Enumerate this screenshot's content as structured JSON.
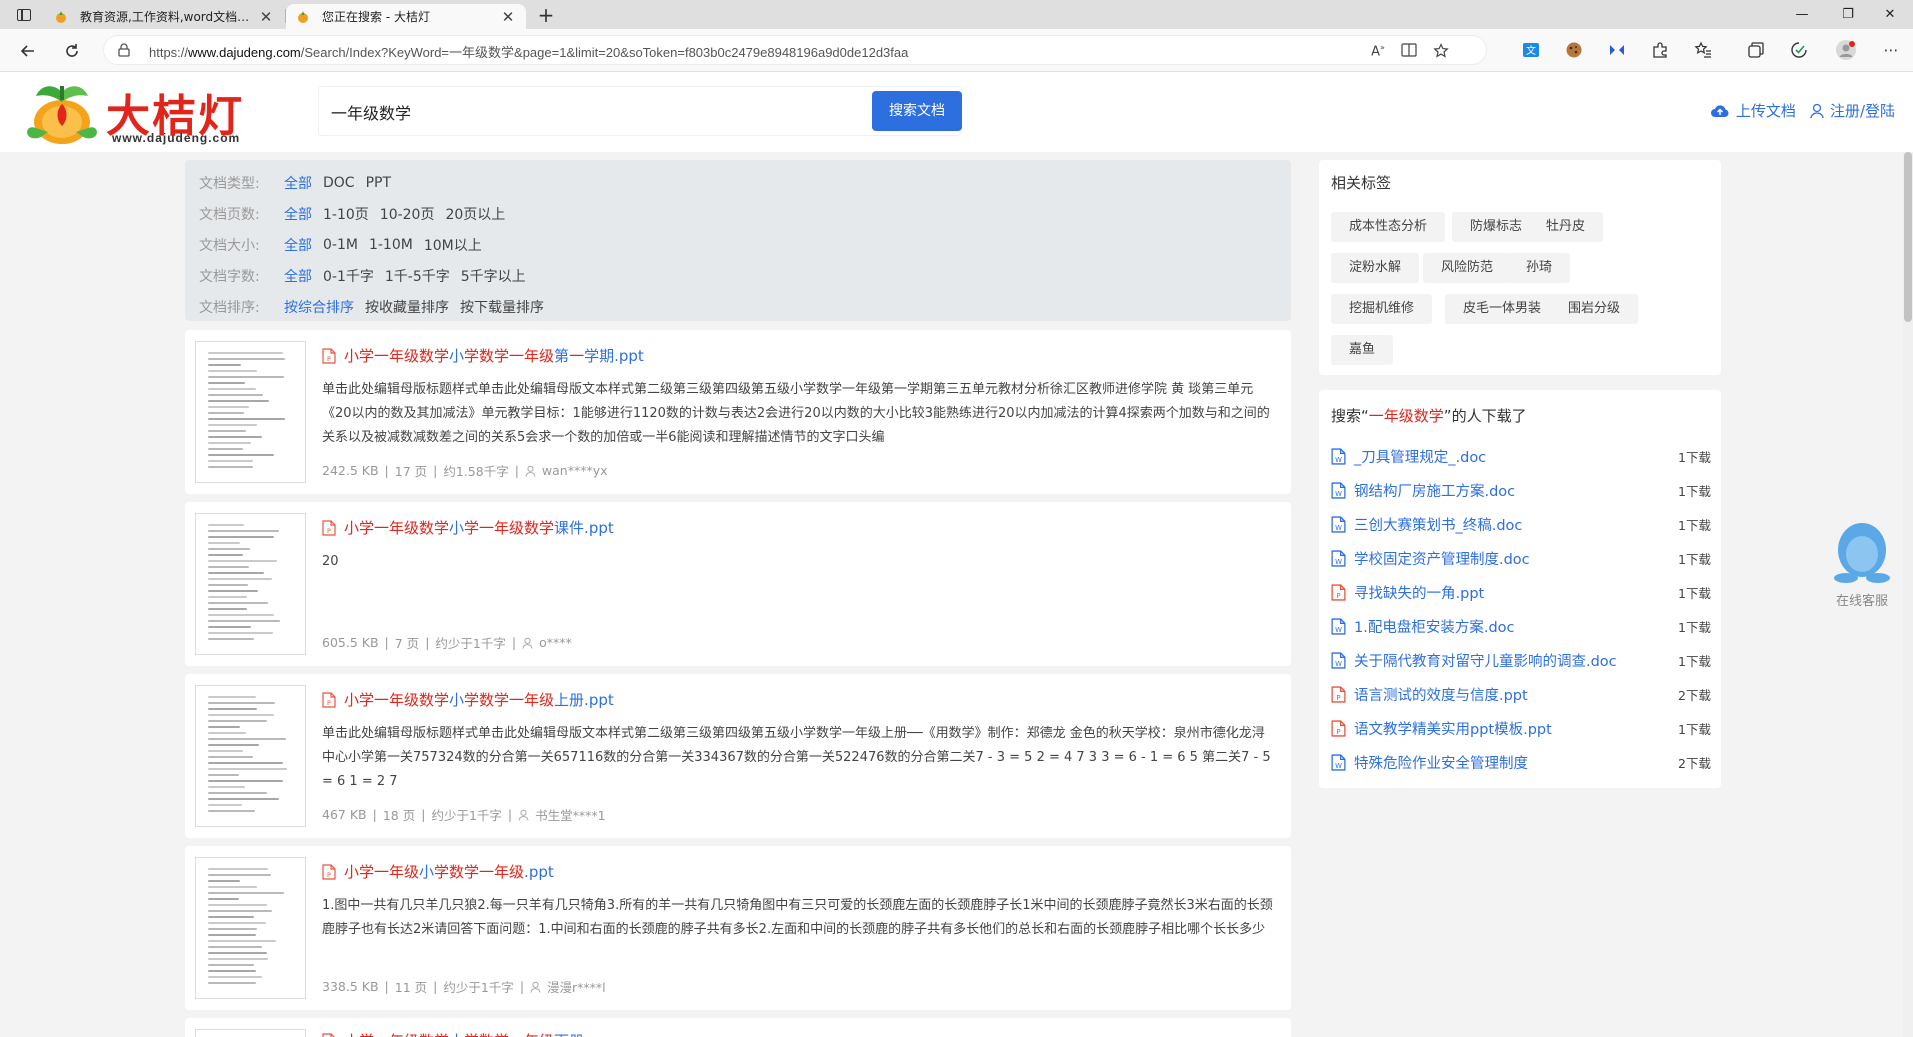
{
  "browser": {
    "tabs": [
      {
        "title": "教育资源,工作资料,word文档,课件",
        "active": false
      },
      {
        "title": "您正在搜索 - 大桔灯",
        "active": true
      }
    ],
    "url_prefix": "https://",
    "url_host": "www.dajudeng.com",
    "url_path": "/Search/Index?KeyWord=一年级数学&page=1&limit=20&soToken=f803b0c2479e8948196a9d0de12d3faa",
    "window_controls": {
      "minimize": "—",
      "restore": "❐",
      "close": "✕"
    }
  },
  "header": {
    "logo_text": "大桔灯",
    "logo_domain": "www.dajudeng.com",
    "search_value": "一年级数学",
    "search_button": "搜索文档",
    "upload_label": "上传文档",
    "login_label": "注册/登陆"
  },
  "filters": [
    {
      "label": "文档类型:",
      "options": [
        "全部",
        "DOC",
        "PPT"
      ],
      "active": 0
    },
    {
      "label": "文档页数:",
      "options": [
        "全部",
        "1-10页",
        "10-20页",
        "20页以上"
      ],
      "active": 0
    },
    {
      "label": "文档大小:",
      "options": [
        "全部",
        "0-1M",
        "1-10M",
        "10M以上"
      ],
      "active": 0
    },
    {
      "label": "文档字数:",
      "options": [
        "全部",
        "0-1千字",
        "1千-5千字",
        "5千字以上"
      ],
      "active": 0
    },
    {
      "label": "文档排序:",
      "options": [
        "按综合排序",
        "按收藏量排序",
        "按下载量排序"
      ],
      "active": 0
    }
  ],
  "results": [
    {
      "title_parts": [
        {
          "t": "小学一年级数学",
          "hl": true
        },
        {
          "t": "小",
          "hl": false
        },
        {
          "t": "学数学一年级",
          "hl": true
        },
        {
          "t": "第",
          "hl": false
        },
        {
          "t": "一",
          "hl": true
        },
        {
          "t": "学期.ppt",
          "hl": false
        }
      ],
      "desc": "单击此处编辑母版标题样式单击此处编辑母版文本样式第二级第三级第四级第五级小学数学一年级第一学期第三五单元教材分析徐汇区教师进修学院 黄 琰第三单元《20以内的数及其加减法》单元教学目标：1能够进行1120数的计数与表达2会进行20以内数的大小比较3能熟练进行20以内加减法的计算4探索两个加数与和之间的关系以及被减数减数差之间的关系5会求一个数的加倍或一半6能阅读和理解描述情节的文字口头编",
      "size": "242.5 KB",
      "pages": "17 页",
      "words": "约1.58千字",
      "author": "wan****yx"
    },
    {
      "title_parts": [
        {
          "t": "小学一年级数学",
          "hl": true
        },
        {
          "t": "小",
          "hl": false
        },
        {
          "t": "学一年级数学",
          "hl": true
        },
        {
          "t": "课件.ppt",
          "hl": false
        }
      ],
      "desc": "20",
      "size": "605.5 KB",
      "pages": "7 页",
      "words": "约少于1千字",
      "author": "o****"
    },
    {
      "title_parts": [
        {
          "t": "小学一年级数学",
          "hl": true
        },
        {
          "t": "小",
          "hl": false
        },
        {
          "t": "学数学一年级",
          "hl": true
        },
        {
          "t": "上册.ppt",
          "hl": false
        }
      ],
      "desc": "单击此处编辑母版标题样式单击此处编辑母版文本样式第二级第三级第四级第五级小学数学一年级上册──《用数学》制作：郑德龙 金色的秋天学校：泉州市德化龙浔中心小学第一关757324数的分合第一关657116数的分合第一关334367数的分合第一关522476数的分合第二关7 - 3 = 5 2 = 4 7 3 3 = 6 - 1 = 6 5 第二关7 - 5 = 6 1 = 2 7",
      "size": "467 KB",
      "pages": "18 页",
      "words": "约少于1千字",
      "author": "书生堂****1"
    },
    {
      "title_parts": [
        {
          "t": "小学一年级",
          "hl": true
        },
        {
          "t": "小",
          "hl": false
        },
        {
          "t": "学数学一年级",
          "hl": true
        },
        {
          "t": ".ppt",
          "hl": false
        }
      ],
      "desc": "1.图中一共有几只羊几只狼2.每一只羊有几只犄角3.所有的羊一共有几只犄角图中有三只可爱的长颈鹿左面的长颈鹿脖子长1米中间的长颈鹿脖子竟然长3米右面的长颈鹿脖子也有长达2米请回答下面问题：1.中间和右面的长颈鹿的脖子共有多长2.左面和中间的长颈鹿的脖子共有多长他们的总长和右面的长颈鹿脖子相比哪个长长多少",
      "size": "338.5 KB",
      "pages": "11 页",
      "words": "约少于1千字",
      "author": "漫漫r****l"
    }
  ],
  "partial_result": {
    "title_parts": [
      {
        "t": "小学一年级数学",
        "hl": true
      },
      {
        "t": "小",
        "hl": false
      },
      {
        "t": "学数学一年级",
        "hl": true
      },
      {
        "t": "下册",
        "hl": false
      }
    ]
  },
  "related_tags": {
    "title": "相关标签",
    "tags": [
      "成本性态分析",
      "防爆标志",
      "牡丹皮",
      "淀粉水解",
      "风险防范",
      "孙琦",
      "挖掘机维修",
      "皮毛一体男装",
      "围岩分级",
      "嘉鱼"
    ]
  },
  "also_downloaded": {
    "title_prefix": "搜索“",
    "title_keyword": "一年级数学",
    "title_suffix": "”的人下载了",
    "items": [
      {
        "name": "_刀具管理规定_.doc",
        "type": "doc",
        "count": "1下载"
      },
      {
        "name": "钢结构厂房施工方案.doc",
        "type": "doc",
        "count": "1下载"
      },
      {
        "name": "三创大赛策划书_终稿.doc",
        "type": "doc",
        "count": "1下载"
      },
      {
        "name": "学校固定资产管理制度.doc",
        "type": "doc",
        "count": "1下载"
      },
      {
        "name": "寻找缺失的一角.ppt",
        "type": "ppt",
        "count": "1下载"
      },
      {
        "name": "1.配电盘柜安装方案.doc",
        "type": "doc",
        "count": "1下载"
      },
      {
        "name": "关于隔代教育对留守儿童影响的调查.doc",
        "type": "doc",
        "count": "1下载"
      },
      {
        "name": "语言测试的效度与信度.ppt",
        "type": "ppt",
        "count": "2下载"
      },
      {
        "name": "语文教学精美实用ppt模板.ppt",
        "type": "ppt",
        "count": "1下载"
      },
      {
        "name": "特殊危险作业安全管理制度",
        "type": "doc",
        "count": "2下载"
      }
    ]
  },
  "service": {
    "label": "在线客服"
  },
  "colors": {
    "accent": "#2e6fe0",
    "highlight": "#e1251b",
    "ppt": "#e8533f",
    "doc": "#2e6fe0"
  }
}
